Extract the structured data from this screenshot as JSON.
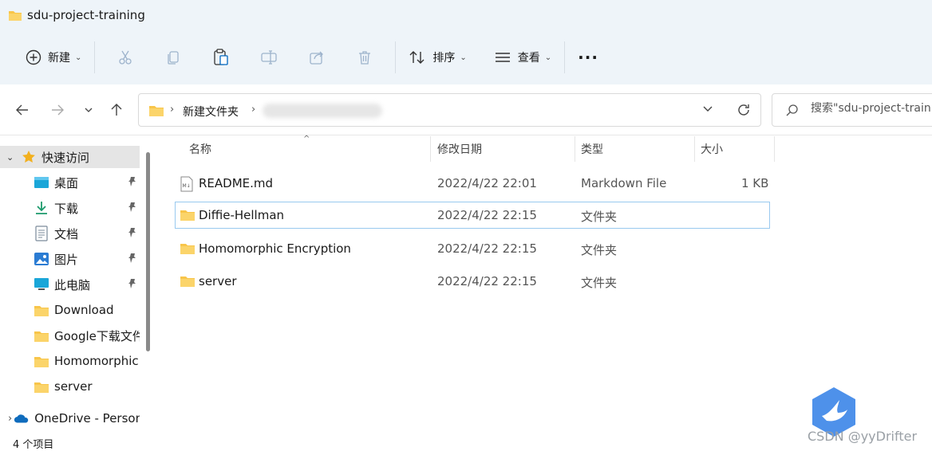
{
  "window": {
    "title": "sdu-project-training"
  },
  "toolbar": {
    "new_label": "新建",
    "sort_label": "排序",
    "view_label": "查看",
    "more_label": "···",
    "icons": [
      "cut-icon",
      "copy-icon",
      "paste-icon",
      "rename-icon",
      "share-icon",
      "delete-icon"
    ]
  },
  "address": {
    "crumbs": [
      "新建文件夹"
    ],
    "blurred_segment": true
  },
  "search": {
    "placeholder": "搜索\"sdu-project-training\""
  },
  "sidebar": {
    "quick_access_label": "快速访问",
    "items": [
      {
        "label": "桌面",
        "icon": "desktop-icon",
        "pinned": true
      },
      {
        "label": "下载",
        "icon": "download-icon",
        "pinned": true
      },
      {
        "label": "文档",
        "icon": "document-icon",
        "pinned": true
      },
      {
        "label": "图片",
        "icon": "pictures-icon",
        "pinned": true
      },
      {
        "label": "此电脑",
        "icon": "computer-icon",
        "pinned": true
      },
      {
        "label": "Download",
        "icon": "folder-icon",
        "pinned": false
      },
      {
        "label": "Google下载文件",
        "icon": "folder-icon",
        "pinned": false
      },
      {
        "label": "Homomorphic Encryption",
        "icon": "folder-icon",
        "pinned": false
      },
      {
        "label": "server",
        "icon": "folder-icon",
        "pinned": false
      }
    ],
    "onedrive_label": "OneDrive - Personal"
  },
  "columns": {
    "name": "名称",
    "modified": "修改日期",
    "type": "类型",
    "size": "大小"
  },
  "files": [
    {
      "name": "README.md",
      "modified": "2022/4/22 22:01",
      "type": "Markdown File",
      "size": "1 KB",
      "icon": "markdown-file-icon"
    },
    {
      "name": "Diffie-Hellman",
      "modified": "2022/4/22 22:15",
      "type": "文件夹",
      "size": "",
      "icon": "folder-icon"
    },
    {
      "name": "Homomorphic Encryption",
      "modified": "2022/4/22 22:15",
      "type": "文件夹",
      "size": "",
      "icon": "folder-icon"
    },
    {
      "name": "server",
      "modified": "2022/4/22 22:15",
      "type": "文件夹",
      "size": "",
      "icon": "folder-icon"
    }
  ],
  "status": {
    "item_count": "4 个项目"
  },
  "watermark": {
    "text": "CSDN @yyDrifter"
  },
  "colors": {
    "folder": "#f8c54a",
    "accent": "#0067c0",
    "chrome": "#eef4f9"
  }
}
